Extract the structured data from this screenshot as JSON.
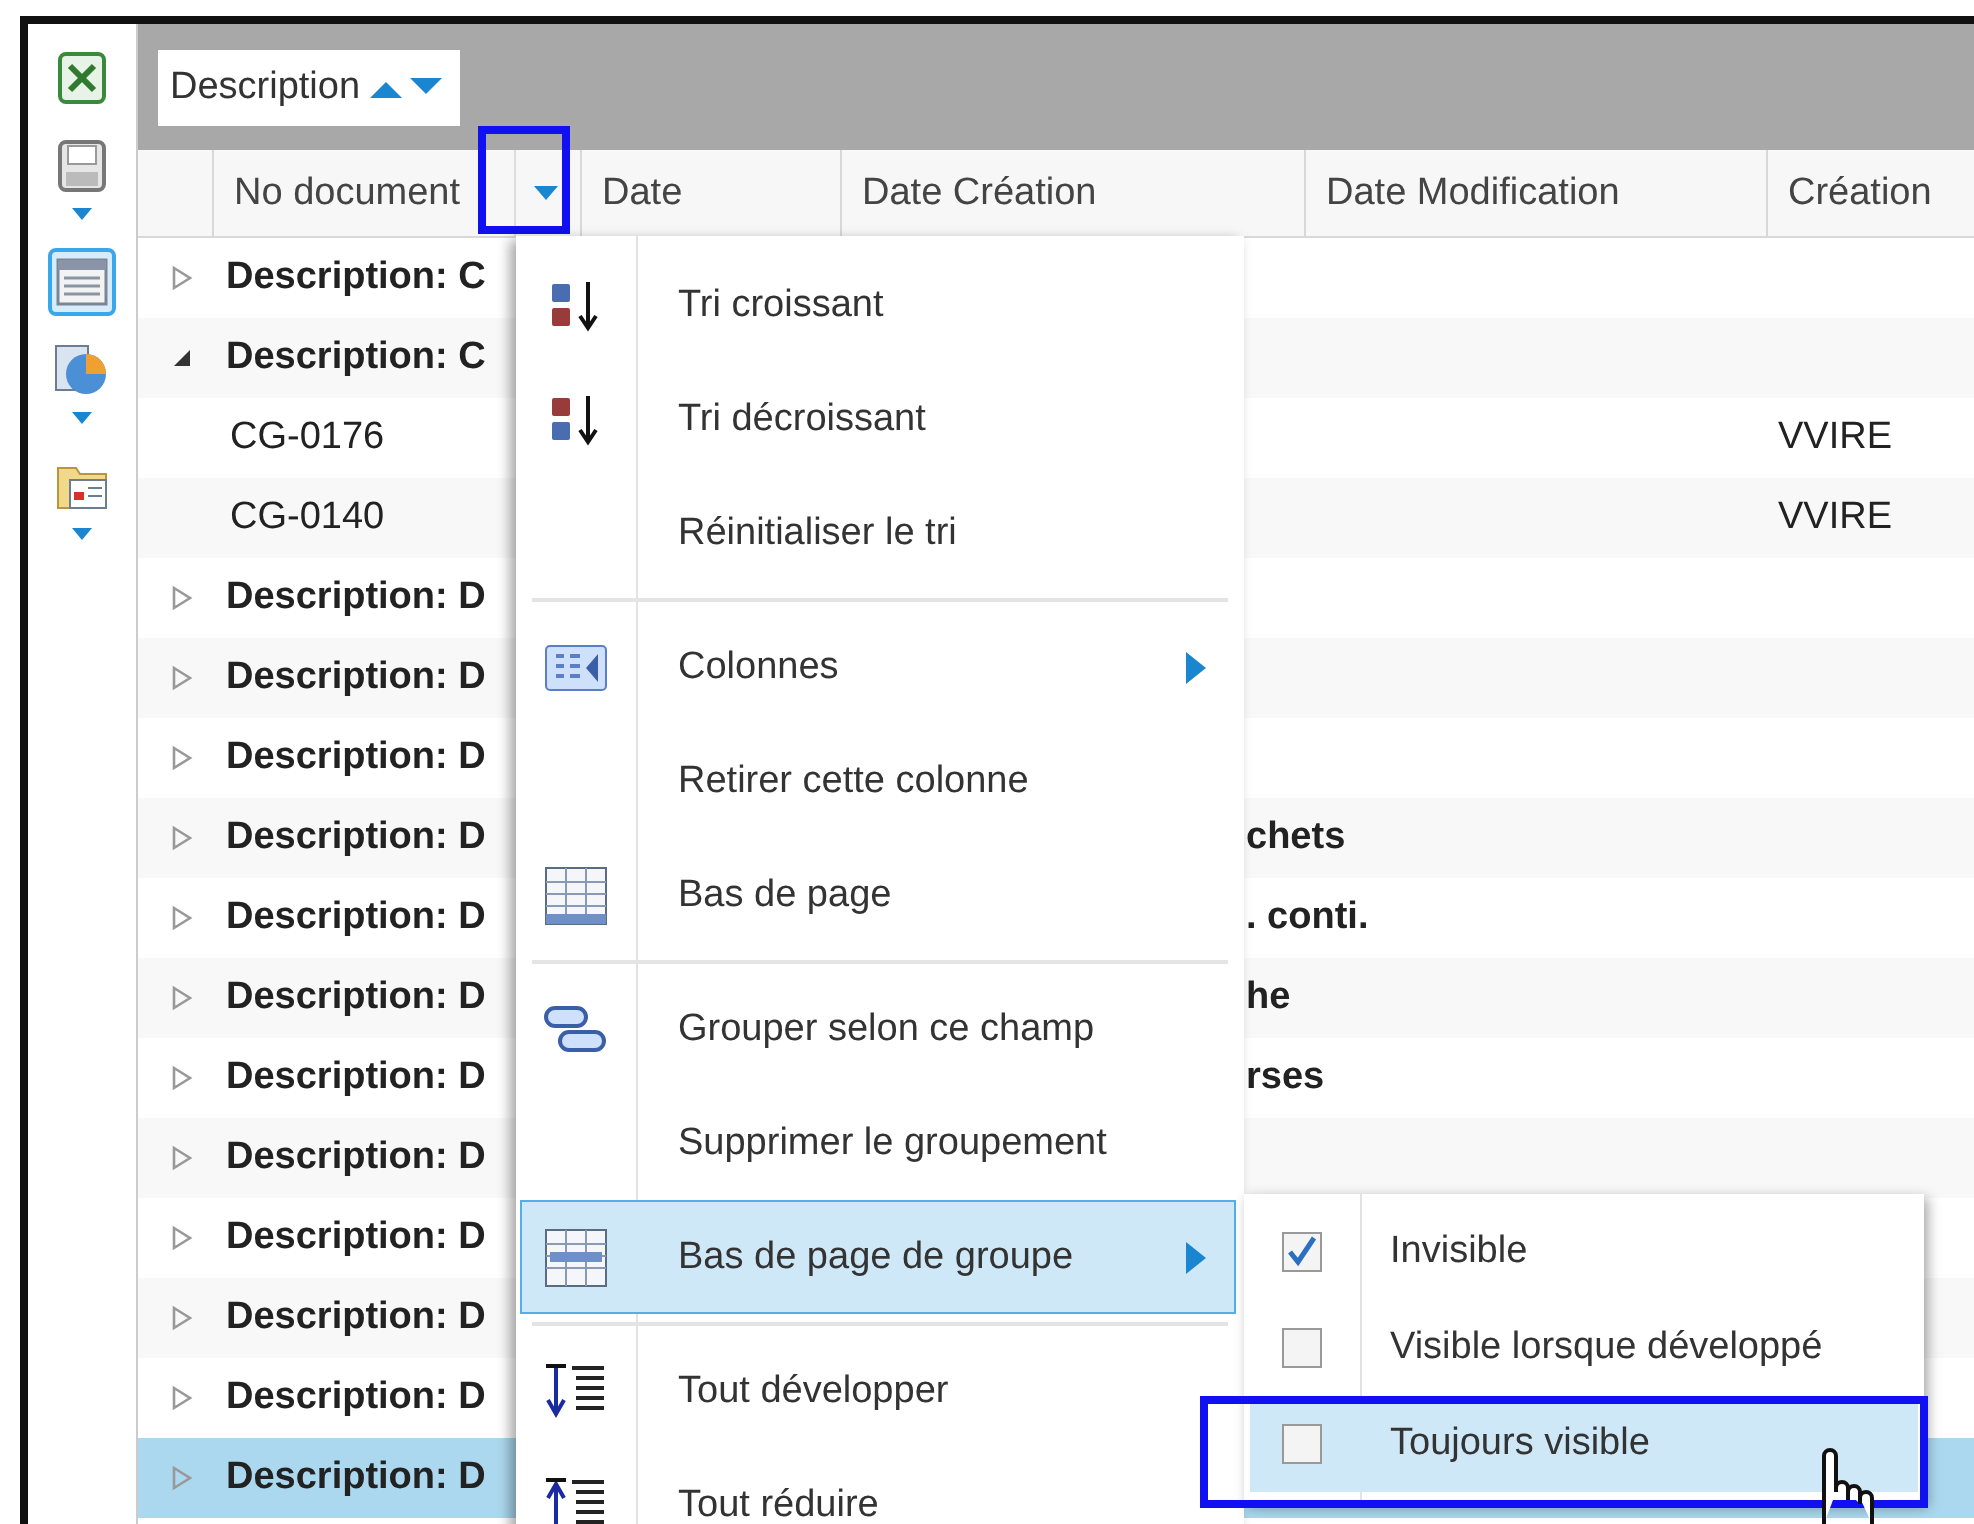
{
  "toolbar": {
    "items": [
      {
        "dropdown": false,
        "selected": false
      },
      {
        "dropdown": true,
        "selected": false
      },
      {
        "dropdown": false,
        "selected": true
      },
      {
        "dropdown": true,
        "selected": false
      },
      {
        "dropdown": true,
        "selected": false
      }
    ]
  },
  "group_bar": {
    "chips": [
      {
        "label": "Description"
      }
    ]
  },
  "table": {
    "columns": [
      {
        "label": "No document",
        "filter_button": true,
        "highlighted": true
      },
      {
        "label": "Date",
        "filter_button": false,
        "highlighted": false
      },
      {
        "label": "Date Création",
        "filter_button": false,
        "highlighted": false
      },
      {
        "label": "Date Modification",
        "filter_button": false,
        "highlighted": false
      },
      {
        "label": "Création",
        "filter_button": false,
        "highlighted": false
      }
    ],
    "rows": [
      {
        "kind": "group",
        "label": "Description: C",
        "expanded": false,
        "selected": false
      },
      {
        "kind": "group",
        "label": "Description: C",
        "expanded": true,
        "selected": false
      },
      {
        "kind": "record",
        "no_document": "CG-0176",
        "creation": "VVIRE",
        "selected": false
      },
      {
        "kind": "record",
        "no_document": "CG-0140",
        "creation": "VVIRE",
        "selected": false
      },
      {
        "kind": "group",
        "label": "Description: D",
        "expanded": false,
        "selected": false
      },
      {
        "kind": "group",
        "label": "Description: D",
        "expanded": false,
        "selected": false
      },
      {
        "kind": "group",
        "label": "Description: D",
        "expanded": false,
        "selected": false
      },
      {
        "kind": "group",
        "label": "Description: D",
        "tail": "chets",
        "expanded": false,
        "selected": false
      },
      {
        "kind": "group",
        "label": "Description: D",
        "tail": ". conti.",
        "expanded": false,
        "selected": false
      },
      {
        "kind": "group",
        "label": "Description: D",
        "tail": "he",
        "expanded": false,
        "selected": false
      },
      {
        "kind": "group",
        "label": "Description: D",
        "tail": "rses",
        "expanded": false,
        "selected": false
      },
      {
        "kind": "group",
        "label": "Description: D",
        "expanded": false,
        "selected": false
      },
      {
        "kind": "group",
        "label": "Description: D",
        "expanded": false,
        "selected": false
      },
      {
        "kind": "group",
        "label": "Description: D",
        "expanded": false,
        "selected": false
      },
      {
        "kind": "group",
        "label": "Description: D",
        "expanded": false,
        "selected": false
      },
      {
        "kind": "group",
        "label": "Description: D",
        "expanded": false,
        "selected": true
      }
    ]
  },
  "context_menu": {
    "items": [
      {
        "kind": "item",
        "label": "Tri croissant",
        "submenu": false,
        "selected": false
      },
      {
        "kind": "item",
        "label": "Tri décroissant",
        "submenu": false,
        "selected": false
      },
      {
        "kind": "item",
        "label": "Réinitialiser le tri",
        "submenu": false,
        "selected": false
      },
      {
        "kind": "separator"
      },
      {
        "kind": "item",
        "label": "Colonnes",
        "submenu": true,
        "selected": false
      },
      {
        "kind": "item",
        "label": "Retirer cette colonne",
        "submenu": false,
        "selected": false
      },
      {
        "kind": "item",
        "label": "Bas de page",
        "submenu": false,
        "selected": false
      },
      {
        "kind": "separator"
      },
      {
        "kind": "item",
        "label": "Grouper selon ce champ",
        "submenu": false,
        "selected": false
      },
      {
        "kind": "item",
        "label": "Supprimer le groupement",
        "submenu": false,
        "selected": false
      },
      {
        "kind": "item",
        "label": "Bas de page de groupe",
        "submenu": true,
        "selected": true
      },
      {
        "kind": "separator"
      },
      {
        "kind": "item",
        "label": "Tout développer",
        "submenu": false,
        "selected": false
      },
      {
        "kind": "item",
        "label": "Tout réduire",
        "submenu": false,
        "selected": false
      }
    ]
  },
  "submenu": {
    "items": [
      {
        "label": "Invisible",
        "checked": true,
        "selected": false
      },
      {
        "label": "Visible lorsque développé",
        "checked": false,
        "selected": false
      },
      {
        "label": "Toujours visible",
        "checked": false,
        "selected": true
      }
    ]
  }
}
